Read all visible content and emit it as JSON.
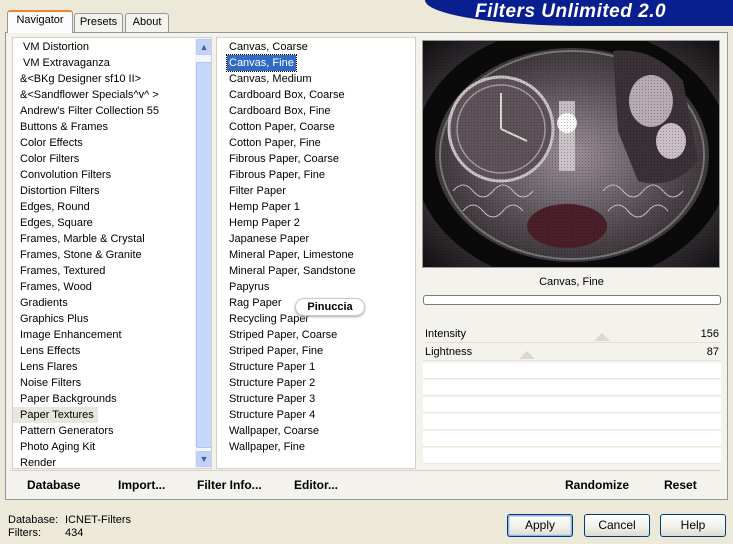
{
  "tabs": [
    {
      "label": "Navigator",
      "active": true
    },
    {
      "label": "Presets",
      "active": false
    },
    {
      "label": "About",
      "active": false
    }
  ],
  "app_title": "Filters Unlimited 2.0",
  "categories": [
    "VM Distortion",
    "VM Extravaganza",
    "&<BKg Designer sf10 II>",
    "&<Sandflower Specials^v^ >",
    "Andrew's Filter Collection 55",
    "Buttons & Frames",
    "Color Effects",
    "Color Filters",
    "Convolution Filters",
    "Distortion Filters",
    "Edges, Round",
    "Edges, Square",
    "Frames, Marble & Crystal",
    "Frames, Stone & Granite",
    "Frames, Textured",
    "Frames, Wood",
    "Gradients",
    "Graphics Plus",
    "Image Enhancement",
    "Lens Effects",
    "Lens Flares",
    "Noise Filters",
    "Paper Backgrounds",
    "Paper Textures",
    "Pattern Generators",
    "Photo Aging Kit",
    "Render"
  ],
  "selected_category": "Paper Textures",
  "filters": [
    "Canvas, Coarse",
    "Canvas, Fine",
    "Canvas, Medium",
    "Cardboard Box, Coarse",
    "Cardboard Box, Fine",
    "Cotton Paper, Coarse",
    "Cotton Paper, Fine",
    "Fibrous Paper, Coarse",
    "Fibrous Paper, Fine",
    "Filter Paper",
    "Hemp Paper 1",
    "Hemp Paper 2",
    "Japanese Paper",
    "Mineral Paper, Limestone",
    "Mineral Paper, Sandstone",
    "Papyrus",
    "Rag Paper",
    "Recycling Paper",
    "Striped Paper, Coarse",
    "Striped Paper, Fine",
    "Structure Paper 1",
    "Structure Paper 2",
    "Structure Paper 3",
    "Structure Paper 4",
    "Wallpaper, Coarse",
    "Wallpaper, Fine"
  ],
  "selected_filter": "Canvas, Fine",
  "watermark": "Pinuccia",
  "preview": {
    "filter_name": "Canvas, Fine"
  },
  "params": [
    {
      "label": "Intensity",
      "value": "156",
      "level": 156,
      "max": 255
    },
    {
      "label": "Lightness",
      "value": "87",
      "level": 87,
      "max": 255
    }
  ],
  "toolbar": {
    "database": "Database",
    "import": "Import...",
    "filter_info": "Filter Info...",
    "editor": "Editor...",
    "randomize": "Randomize",
    "reset": "Reset"
  },
  "info": {
    "database_label": "Database:",
    "database_value": "ICNET-Filters",
    "filters_label": "Filters:",
    "filters_value": "434"
  },
  "buttons": {
    "apply": "Apply",
    "cancel": "Cancel",
    "help": "Help"
  },
  "colors": {
    "selection": "#316ac5",
    "logo_band": "#0a1f8f",
    "tab_accent": "#e68b2c"
  }
}
